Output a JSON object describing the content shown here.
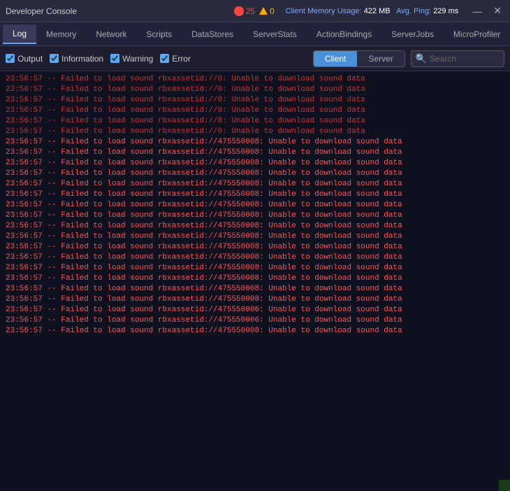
{
  "titleBar": {
    "title": "Developer Console",
    "errorCount": "25",
    "warningCount": "0",
    "memoryLabel": "Client Memory Usage:",
    "memoryValue": "422 MB",
    "pingLabel": "Avg. Ping:",
    "pingValue": "229 ms",
    "minimizeBtn": "—",
    "closeBtn": "✕"
  },
  "navTabs": [
    {
      "id": "log",
      "label": "Log",
      "active": true
    },
    {
      "id": "memory",
      "label": "Memory",
      "active": false
    },
    {
      "id": "network",
      "label": "Network",
      "active": false
    },
    {
      "id": "scripts",
      "label": "Scripts",
      "active": false
    },
    {
      "id": "datastores",
      "label": "DataStores",
      "active": false
    },
    {
      "id": "serverstats",
      "label": "ServerStats",
      "active": false
    },
    {
      "id": "actionbindings",
      "label": "ActionBindings",
      "active": false
    },
    {
      "id": "serverjobs",
      "label": "ServerJobs",
      "active": false
    },
    {
      "id": "microprofiler",
      "label": "MicroProfiler",
      "active": false
    }
  ],
  "toolbar": {
    "outputLabel": "Output",
    "infoLabel": "Information",
    "warningLabel": "Warning",
    "errorLabel": "Error",
    "clientLabel": "Client",
    "serverLabel": "Server",
    "searchPlaceholder": "Search"
  },
  "logLines": [
    {
      "text": "23:56:57  -- Failed to load sound rbxassetid://0: Unable to download sound data",
      "style": "error"
    },
    {
      "text": "23:56:57  -- Failed to load sound rbxassetid://0: Unable to download sound data",
      "style": "error"
    },
    {
      "text": "23:56:57  -- Failed to load sound rbxassetid://0: Unable to download sound data",
      "style": "error"
    },
    {
      "text": "23:56:57  -- Failed to load sound rbxassetid://0: Unable to download sound data",
      "style": "error"
    },
    {
      "text": "23:56:57  -- Failed to load sound rbxassetid://0: Unable to download sound data",
      "style": "error"
    },
    {
      "text": "23:56:57  -- Failed to load sound rbxassetid://0: Unable to download sound data",
      "style": "error"
    },
    {
      "text": "23:56:57  -- Failed to load sound rbxassetid://475550008: Unable to download sound data",
      "style": "error-bright"
    },
    {
      "text": "23:56:57  -- Failed to load sound rbxassetid://475550008: Unable to download sound data",
      "style": "error-bright"
    },
    {
      "text": "23:56:57  -- Failed to load sound rbxassetid://475550008: Unable to download sound data",
      "style": "error-bright"
    },
    {
      "text": "23:56:57  -- Failed to load sound rbxassetid://475550008: Unable to download sound data",
      "style": "error-bright"
    },
    {
      "text": "23:56:57  -- Failed to load sound rbxassetid://475550008: Unable to download sound data",
      "style": "error-bright"
    },
    {
      "text": "23:56:57  -- Failed to load sound rbxassetid://475550008: Unable to download sound data",
      "style": "error-bright"
    },
    {
      "text": "23:56:57  -- Failed to load sound rbxassetid://475550008: Unable to download sound data",
      "style": "error-bright"
    },
    {
      "text": "23:56:57  -- Failed to load sound rbxassetid://475550008: Unable to download sound data",
      "style": "error-bright"
    },
    {
      "text": "23:56:57  -- Failed to load sound rbxassetid://475550008: Unable to download sound data",
      "style": "error-bright"
    },
    {
      "text": "23:56:57  -- Failed to load sound rbxassetid://475550008: Unable to download sound data",
      "style": "error-bright"
    },
    {
      "text": "23:56:57  -- Failed to load sound rbxassetid://475550008: Unable to download sound data",
      "style": "error-bright"
    },
    {
      "text": "23:56:57  -- Failed to load sound rbxassetid://475550008: Unable to download sound data",
      "style": "error-bright"
    },
    {
      "text": "23:56:57  -- Failed to load sound rbxassetid://475550008: Unable to download sound data",
      "style": "error-bright"
    },
    {
      "text": "23:56:57  -- Failed to load sound rbxassetid://475550008: Unable to download sound data",
      "style": "error-bright"
    },
    {
      "text": "23:56:57  -- Failed to load sound rbxassetid://475550008: Unable to download sound data",
      "style": "error-bright"
    },
    {
      "text": "23:56:57  -- Failed to load sound rbxassetid://475550008: Unable to download sound data",
      "style": "error-bright"
    },
    {
      "text": "23:56:57  -- Failed to load sound rbxassetid://475550006: Unable to download sound data",
      "style": "error-bright"
    },
    {
      "text": "23:56:57  -- Failed to load sound rbxassetid://475550006: Unable to download sound data",
      "style": "error-bright"
    },
    {
      "text": "23:56:57  -- Failed to load sound rbxassetid://475550008: Unable to download sound data",
      "style": "error-bright"
    }
  ]
}
